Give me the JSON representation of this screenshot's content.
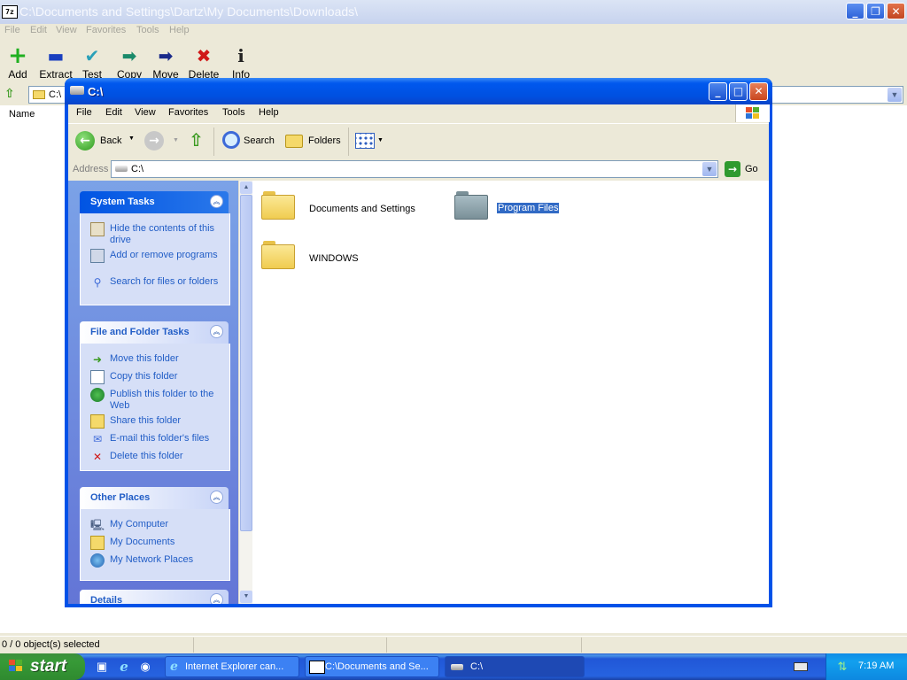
{
  "zip": {
    "title": "C:\\Documents and Settings\\Dartz\\My Documents\\Downloads\\",
    "logo": "7z",
    "window_buttons": {
      "minimize": "_",
      "maximize": "❐",
      "close": "✕"
    },
    "menu": [
      "File",
      "Edit",
      "View",
      "Favorites",
      "Tools",
      "Help"
    ],
    "toolbar": [
      {
        "label": "Add",
        "icon": "plus-icon",
        "glyph": "+",
        "color": "#20b020"
      },
      {
        "label": "Extract",
        "icon": "minus-icon",
        "glyph": "▬",
        "color": "#1a3fbf"
      },
      {
        "label": "Test",
        "icon": "check-icon",
        "glyph": "✔",
        "color": "#2aa0b8"
      },
      {
        "label": "Copy",
        "icon": "copy-arrow-icon",
        "glyph": "➡",
        "color": "#1a8a6a"
      },
      {
        "label": "Move",
        "icon": "move-arrow-icon",
        "glyph": "➡",
        "color": "#1a2a8a"
      },
      {
        "label": "Delete",
        "icon": "delete-icon",
        "glyph": "✖",
        "color": "#d01818"
      },
      {
        "label": "Info",
        "icon": "info-icon",
        "glyph": "i",
        "color": "#222222"
      }
    ],
    "address_prefix": "C:\\",
    "list_header_name": "Name",
    "status": "0 / 0 object(s) selected"
  },
  "explorer": {
    "title": "C:\\",
    "menu": [
      "File",
      "Edit",
      "View",
      "Favorites",
      "Tools",
      "Help"
    ],
    "toolbar": {
      "back": "Back",
      "search": "Search",
      "folders": "Folders"
    },
    "address_label": "Address",
    "address_value": "C:\\",
    "go_label": "Go",
    "system_tasks": {
      "title": "System Tasks",
      "items": [
        {
          "label": "Hide the contents of this drive",
          "icon": "hide-drive-icon"
        },
        {
          "label": "Add or remove programs",
          "icon": "add-remove-programs-icon"
        },
        {
          "label": "Search for files or folders",
          "icon": "search-icon"
        }
      ]
    },
    "file_folder_tasks": {
      "title": "File and Folder Tasks",
      "items": [
        {
          "label": "Move this folder",
          "icon": "move-folder-icon"
        },
        {
          "label": "Copy this folder",
          "icon": "copy-folder-icon"
        },
        {
          "label": "Publish this folder to the Web",
          "icon": "publish-web-icon"
        },
        {
          "label": "Share this folder",
          "icon": "share-folder-icon"
        },
        {
          "label": "E-mail this folder's files",
          "icon": "email-icon"
        },
        {
          "label": "Delete this folder",
          "icon": "delete-icon"
        }
      ]
    },
    "other_places": {
      "title": "Other Places",
      "items": [
        {
          "label": "My Computer",
          "icon": "my-computer-icon"
        },
        {
          "label": "My Documents",
          "icon": "my-documents-icon"
        },
        {
          "label": "My Network Places",
          "icon": "network-places-icon"
        }
      ]
    },
    "details": {
      "title": "Details"
    },
    "folders": [
      {
        "name": "Documents and Settings",
        "selected": false
      },
      {
        "name": "Program Files",
        "selected": true
      },
      {
        "name": "WINDOWS",
        "selected": false
      }
    ]
  },
  "taskbar": {
    "start": "start",
    "buttons": [
      {
        "label": "Internet Explorer can...",
        "active": false
      },
      {
        "label": "C:\\Documents and Se...",
        "active": false
      },
      {
        "label": "C:\\",
        "active": true
      }
    ],
    "clock": "7:19 AM"
  },
  "colors": {
    "xp_blue": "#0054e3",
    "link_blue": "#215dc6",
    "folder_yellow": "#f5d96a",
    "folder_gray": "#8aa0a8",
    "selection": "#316ac5"
  }
}
